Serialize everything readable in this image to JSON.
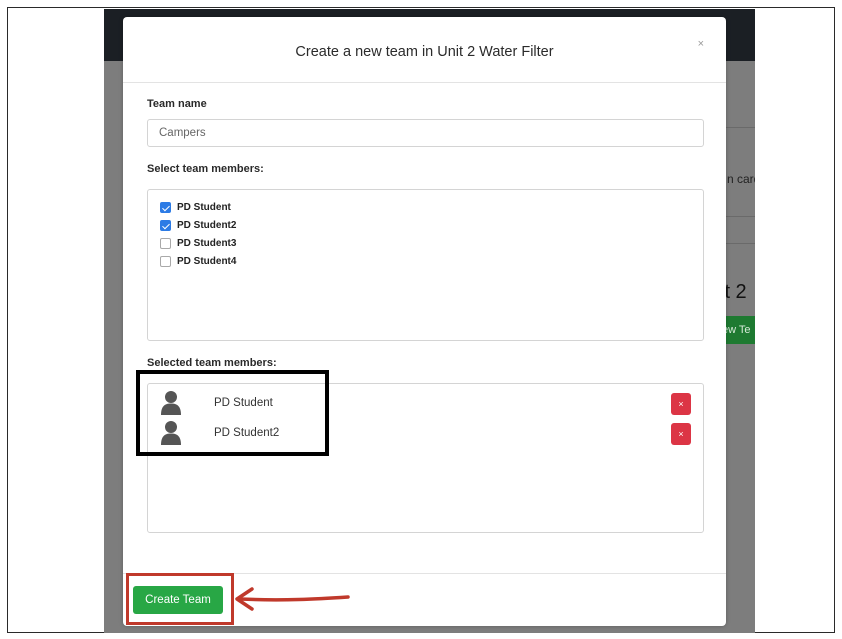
{
  "modal": {
    "title": "Create a new team in Unit 2 Water Filter",
    "close_label": "×"
  },
  "form": {
    "team_name_label": "Team name",
    "team_name_value": "Campers",
    "select_members_label": "Select team members:",
    "members": [
      {
        "label": "PD Student",
        "checked": true
      },
      {
        "label": "PD Student2",
        "checked": true
      },
      {
        "label": "PD Student3",
        "checked": false
      },
      {
        "label": "PD Student4",
        "checked": false
      }
    ],
    "selected_members_label": "Selected team members:",
    "selected_members": [
      {
        "name": "PD Student",
        "remove_label": "×"
      },
      {
        "name": "PD Student2",
        "remove_label": "×"
      }
    ]
  },
  "footer": {
    "create_button_label": "Create Team"
  },
  "background": {
    "peek_card_text": "n card",
    "peek_title_text": "it 2",
    "peek_button_text": "ew Te"
  },
  "colors": {
    "primary_checkbox": "#2c7be5",
    "remove_button": "#dc3545",
    "create_button": "#28a745",
    "highlight_box": "#000000",
    "highlight_create": "#c0392b"
  },
  "icons": {
    "member_avatar": "person-icon",
    "close": "close-icon",
    "remove": "remove-icon",
    "annotation_arrow": "arrow-left-icon"
  }
}
